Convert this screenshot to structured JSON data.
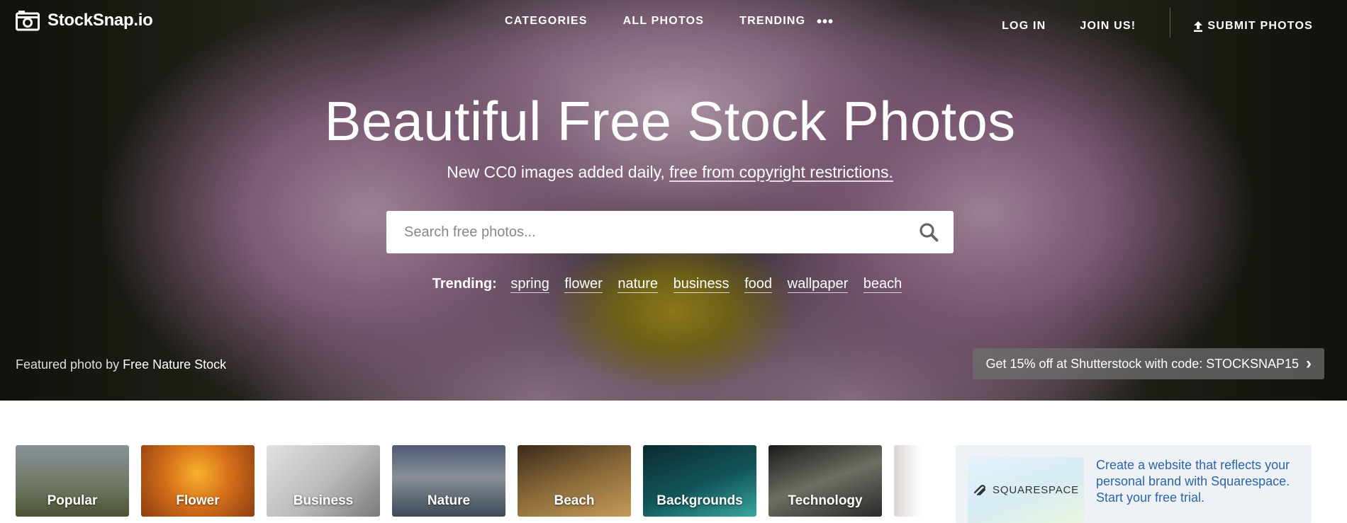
{
  "brand": {
    "name": "StockSnap.io",
    "logo_icon": "camera-icon"
  },
  "nav": {
    "categories": "CATEGORIES",
    "all_photos": "ALL PHOTOS",
    "trending": "TRENDING",
    "more": "•••",
    "login": "LOG IN",
    "join": "JOIN US!",
    "submit": "SUBMIT PHOTOS"
  },
  "hero": {
    "title": "Beautiful Free Stock Photos",
    "subtitle_prefix": "New CC0 images added daily, ",
    "subtitle_link": "free from copyright restrictions.",
    "search_placeholder": "Search free photos...",
    "trending_label": "Trending:",
    "trending": [
      "spring",
      "flower",
      "nature",
      "business",
      "food",
      "wallpaper",
      "beach"
    ],
    "featured_prefix": "Featured photo by ",
    "featured_author": "Free Nature Stock",
    "promo": "Get 15% off at Shutterstock with code: STOCKSNAP15",
    "promo_chevron": "›"
  },
  "categories": [
    "Popular",
    "Flower",
    "Business",
    "Nature",
    "Beach",
    "Backgrounds",
    "Technology"
  ],
  "ad": {
    "brand": "SQUARESPACE",
    "text": "Create a website that reflects your personal brand with Squarespace. Start your free trial."
  },
  "colors": {
    "ad_link": "#2a66a8",
    "ad_bg": "#eef1f5"
  }
}
